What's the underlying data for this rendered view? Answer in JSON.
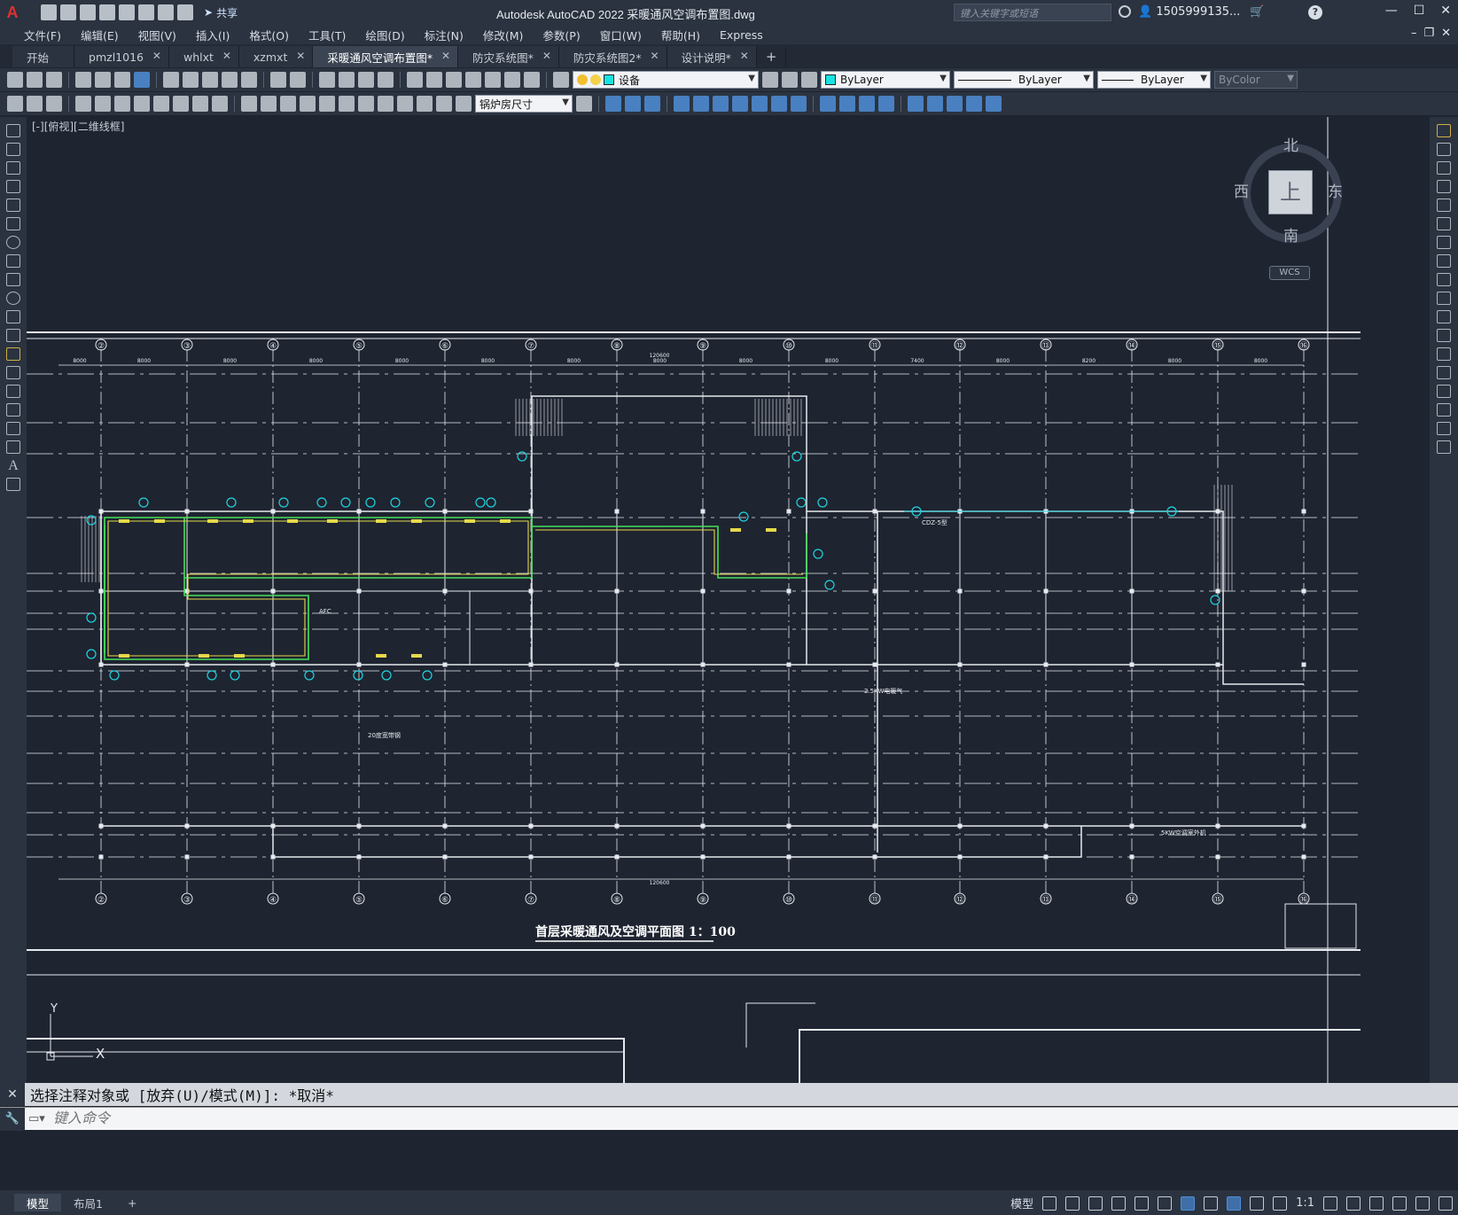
{
  "app": {
    "logo": "A",
    "title": "Autodesk AutoCAD 2022    采暖通风空调布置图.dwg",
    "share": "共享",
    "search_placeholder": "键入关键字或短语",
    "user": "1505999135...",
    "help": "?"
  },
  "menu": [
    "文件(F)",
    "编辑(E)",
    "视图(V)",
    "插入(I)",
    "格式(O)",
    "工具(T)",
    "绘图(D)",
    "标注(N)",
    "修改(M)",
    "参数(P)",
    "窗口(W)",
    "帮助(H)",
    "Express"
  ],
  "tabs": [
    {
      "label": "开始"
    },
    {
      "label": "pmzl1016"
    },
    {
      "label": "whlxt"
    },
    {
      "label": "xzmxt"
    },
    {
      "label": "采暖通风空调布置图*"
    },
    {
      "label": "防灾系统图*"
    },
    {
      "label": "防灾系统图2*"
    },
    {
      "label": "设计说明*"
    }
  ],
  "toolbar": {
    "layer": "设备",
    "color": "ByLayer",
    "linetype": "ByLayer",
    "lineweight": "ByLayer",
    "plotstyle": "ByColor",
    "dimstyle": "锅炉房尺寸"
  },
  "viewport": {
    "label": "[-][俯视][二维线框]",
    "north": "北",
    "south": "南",
    "east": "东",
    "west": "西",
    "face": "上",
    "wcs": "WCS"
  },
  "drawing": {
    "title": "首层采暖通风及空调平面图  1：100",
    "top_axes": [
      "②",
      "③",
      "④",
      "⑤",
      "⑥",
      "⑦",
      "⑧",
      "⑨",
      "⑩",
      "⑪",
      "⑫",
      "⑬",
      "⑭",
      "⑮",
      "⑯"
    ],
    "bottom_axes": [
      "②",
      "③",
      "④",
      "⑤",
      "⑥",
      "⑦",
      "⑧",
      "⑨",
      "⑩",
      "⑪",
      "⑫",
      "⑬",
      "⑭",
      "⑮",
      "⑯"
    ],
    "top_dims": [
      "8000",
      "8000",
      "8000",
      "8000",
      "8000",
      "8000",
      "8000",
      "8000",
      "8000",
      "8000",
      "7400",
      "8000",
      "8200",
      "8000",
      "8000"
    ],
    "total_dim": "120600",
    "ucs_y": "Y",
    "ucs_x": "X",
    "notes": [
      "20度宽带钢",
      "2.5KW电暖气",
      "5KW空调室外机",
      "CDZ-5型",
      "AFC"
    ]
  },
  "command": {
    "history": "选择注释对象或 [放弃(U)/模式(M)]: *取消*",
    "placeholder": "键入命令"
  },
  "layouts": [
    "模型",
    "布局1",
    "+"
  ],
  "status": {
    "model": "模型",
    "scale": "1:1"
  }
}
